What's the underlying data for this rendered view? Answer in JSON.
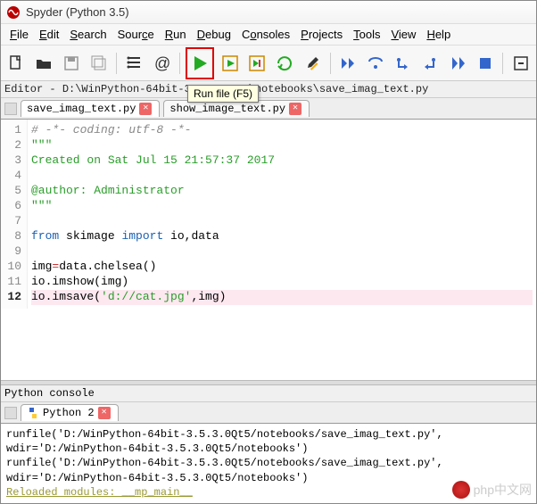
{
  "window": {
    "title": "Spyder (Python 3.5)"
  },
  "menu": {
    "file": "File",
    "edit": "Edit",
    "search": "Search",
    "source": "Source",
    "run": "Run",
    "debug": "Debug",
    "consoles": "Consoles",
    "projects": "Projects",
    "tools": "Tools",
    "view": "View",
    "help": "Help"
  },
  "tooltip": "Run file (F5)",
  "pathbar_prefix": "Editor - ",
  "pathbar_path": "D:\\WinPython-64bit-3.5.3.0Qt5\\notebooks\\save_imag_text.py",
  "tabs": {
    "active": "save_imag_text.py",
    "other": "show_image_text.py"
  },
  "code_lines": [
    {
      "n": 1,
      "cls": "c-comment",
      "text": "# -*- coding: utf-8 -*-"
    },
    {
      "n": 2,
      "cls": "c-str",
      "text": "\"\"\""
    },
    {
      "n": 3,
      "cls": "c-str",
      "text": "Created on Sat Jul 15 21:57:37 2017"
    },
    {
      "n": 4,
      "cls": "",
      "text": ""
    },
    {
      "n": 5,
      "cls": "c-str",
      "text": "@author: Administrator"
    },
    {
      "n": 6,
      "cls": "c-str",
      "text": "\"\"\""
    },
    {
      "n": 7,
      "cls": "",
      "text": ""
    }
  ],
  "code_import": {
    "kw1": "from",
    "mod": " skimage ",
    "kw2": "import",
    "rest": " io,data"
  },
  "code_tail": [
    {
      "n": 9,
      "text": ""
    },
    {
      "n": 10,
      "prefix": "img",
      "op": "=",
      "rest": "data.chelsea()"
    },
    {
      "n": 11,
      "text": "io.imshow(img)"
    }
  ],
  "code_hl": {
    "n": 12,
    "call": "io.imsave(",
    "str": "'d://cat.jpg'",
    "rest": ",img)"
  },
  "console": {
    "header": "Python console",
    "tab": "Python 2",
    "line1": "runfile('D:/WinPython-64bit-3.5.3.0Qt5/notebooks/save_imag_text.py', wdir='D:/WinPython-64bit-3.5.3.0Qt5/notebooks')",
    "line2": "runfile('D:/WinPython-64bit-3.5.3.0Qt5/notebooks/save_imag_text.py', wdir='D:/WinPython-64bit-3.5.3.0Qt5/notebooks')",
    "reload": "Reloaded modules: __mp_main__"
  },
  "watermark": "php中文网"
}
